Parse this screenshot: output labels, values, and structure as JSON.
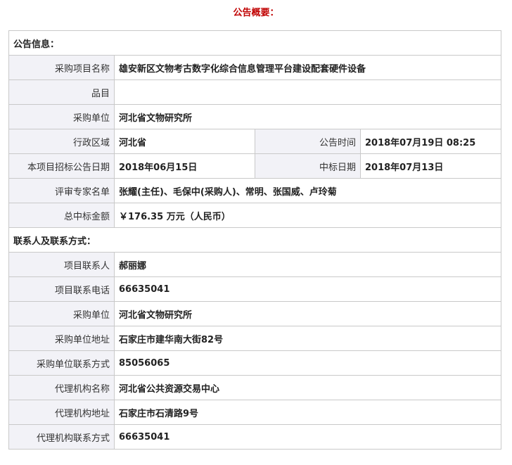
{
  "title": "公告概要：",
  "sections": {
    "notice_info": "公告信息：",
    "contact_info": "联系人及联系方式："
  },
  "notice": {
    "project_name": {
      "label": "采购项目名称",
      "value": "雄安新区文物考古数字化综合信息管理平台建设配套硬件设备"
    },
    "category": {
      "label": "品目",
      "value": ""
    },
    "purchaser": {
      "label": "采购单位",
      "value": "河北省文物研究所"
    },
    "region": {
      "label": "行政区域",
      "value": "河北省"
    },
    "announce_time": {
      "label": "公告时间",
      "value": "2018年07月19日 08:25"
    },
    "tender_date": {
      "label": "本项目招标公告日期",
      "value": "2018年06月15日"
    },
    "award_date": {
      "label": "中标日期",
      "value": "2018年07月13日"
    },
    "experts": {
      "label": "评审专家名单",
      "value": "张耀(主任)、毛保中(采购人)、常明、张国威、卢玲菊"
    },
    "amount": {
      "label": "总中标金额",
      "value": "￥176.35 万元（人民币）"
    }
  },
  "contacts": {
    "project_contact": {
      "label": "项目联系人",
      "value": "郝丽娜"
    },
    "project_phone": {
      "label": "项目联系电话",
      "value": "66635041"
    },
    "purchaser": {
      "label": "采购单位",
      "value": "河北省文物研究所"
    },
    "purchaser_address": {
      "label": "采购单位地址",
      "value": "石家庄市建华南大街82号"
    },
    "purchaser_phone": {
      "label": "采购单位联系方式",
      "value": "85056065"
    },
    "agency_name": {
      "label": "代理机构名称",
      "value": "河北省公共资源交易中心"
    },
    "agency_address": {
      "label": "代理机构地址",
      "value": "石家庄市石清路9号"
    },
    "agency_phone": {
      "label": "代理机构联系方式",
      "value": "66635041"
    }
  }
}
